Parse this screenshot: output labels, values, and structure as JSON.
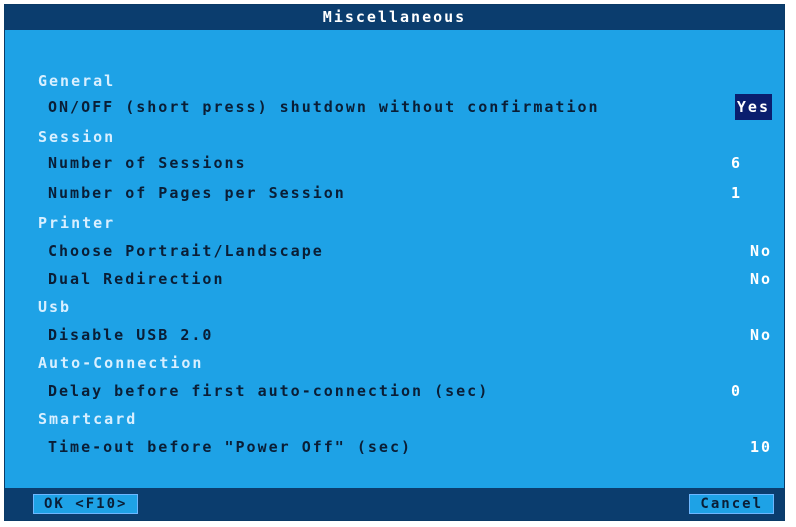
{
  "window": {
    "title": "Miscellaneous"
  },
  "sections": {
    "general": {
      "title": "General",
      "items": [
        {
          "label": "ON/OFF (short press) shutdown without confirmation",
          "value": "Yes"
        }
      ]
    },
    "session": {
      "title": "Session",
      "items": [
        {
          "label": "Number of Sessions",
          "value": "6"
        },
        {
          "label": "Number of Pages per Session",
          "value": "1"
        }
      ]
    },
    "printer": {
      "title": "Printer",
      "items": [
        {
          "label": "Choose Portrait/Landscape",
          "value": "No"
        },
        {
          "label": "Dual Redirection",
          "value": "No"
        }
      ]
    },
    "usb": {
      "title": "Usb",
      "items": [
        {
          "label": "Disable USB 2.0",
          "value": "No"
        }
      ]
    },
    "auto_connection": {
      "title": "Auto-Connection",
      "items": [
        {
          "label": "Delay before first auto-connection (sec)",
          "value": "0"
        }
      ]
    },
    "smartcard": {
      "title": "Smartcard",
      "items": [
        {
          "label": "Time-out before \"Power Off\" (sec)",
          "value": "10"
        }
      ]
    }
  },
  "buttons": {
    "ok": "OK <F10>",
    "cancel": "Cancel"
  },
  "colors": {
    "panel": "#1ea2e6",
    "bar": "#0b3d6e",
    "section_text": "#d8efff",
    "label_text": "#0a1e36",
    "value_text": "#ffffff",
    "selection": "#0a1e6e"
  }
}
